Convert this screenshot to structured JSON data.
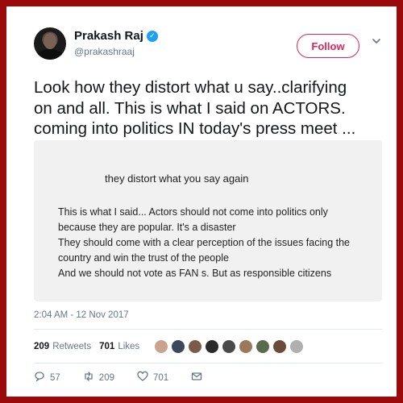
{
  "header": {
    "display_name": "Prakash Raj",
    "verified_glyph": "✓",
    "handle": "@prakashraaj",
    "follow_label": "Follow",
    "chevron": "⌄"
  },
  "tweet": {
    "lines": [
      "Look how they distort what u say..clarifying",
      "on and all. This is what I said on ACTORS.",
      "coming into politics IN today's press meet ..."
    ]
  },
  "image_card": {
    "heading": "they distort what you say again",
    "lines": [
      "This is what I said... Actors should not come into politics only",
      "because they are popular. It's a disaster",
      "They should come with a clear perception of the issues facing the",
      "country and win the trust of the people",
      "And we should not vote as FAN s. But as responsible citizens"
    ]
  },
  "timestamp": "2:04 AM - 12 Nov 2017",
  "stats": {
    "retweets_count": "209",
    "retweets_label": "Retweets",
    "likes_count": "701",
    "likes_label": "Likes",
    "liker_avatar_colors": [
      "#c9a38e",
      "#3a4a5c",
      "#7a5a48",
      "#2b2b2b",
      "#4a4a4a",
      "#9a7a5a",
      "#5a6a4a",
      "#6b4b3b",
      "#b0b0b0"
    ]
  },
  "actions": {
    "replies": "57",
    "retweets": "209",
    "likes": "701"
  },
  "colors": {
    "frame": "#9b0a0a",
    "accent_follow": "#e0245e",
    "verified": "#1da1f2",
    "secondary_text": "#657786"
  }
}
